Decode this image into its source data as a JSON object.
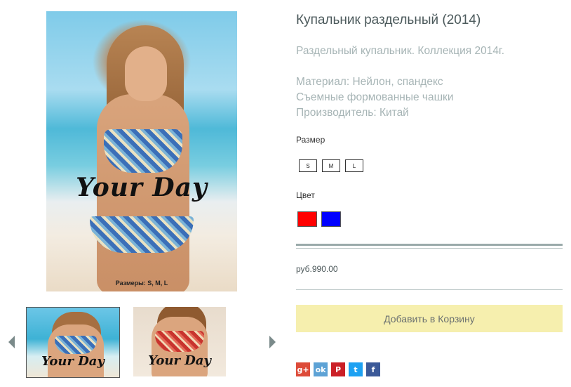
{
  "product": {
    "title": "Купальник раздельный (2014)",
    "desc_line1": "Раздельный купальник. Коллекция 2014г.",
    "desc_line2": "Материал: Нейлон, спандекс",
    "desc_line3": "Съемные формованные чашки",
    "desc_line4": "Производитель: Китай",
    "price": "руб.990.00"
  },
  "image": {
    "brand_text": "Your Day",
    "sizes_caption": "Размеры: S, M, L"
  },
  "thumbnails": [
    {
      "brand_text": "Your Day",
      "swimsuit_color": "#3b6fb8"
    },
    {
      "brand_text": "Your Day",
      "swimsuit_color": "#c8342e"
    }
  ],
  "size": {
    "label": "Размер",
    "options": [
      "S",
      "M",
      "L"
    ]
  },
  "color": {
    "label": "Цвет",
    "options": [
      "#ff0000",
      "#0000ff"
    ]
  },
  "cart": {
    "button_label": "Добавить в Корзину"
  },
  "share": [
    {
      "name": "google-plus",
      "glyph": "g+",
      "color": "#dd4b39"
    },
    {
      "name": "odnoklassniki",
      "glyph": "ok",
      "color": "#5da2d5"
    },
    {
      "name": "pinterest",
      "glyph": "P",
      "color": "#cb2027"
    },
    {
      "name": "twitter",
      "glyph": "t",
      "color": "#1da1f2"
    },
    {
      "name": "facebook",
      "glyph": "f",
      "color": "#3b5998"
    }
  ]
}
